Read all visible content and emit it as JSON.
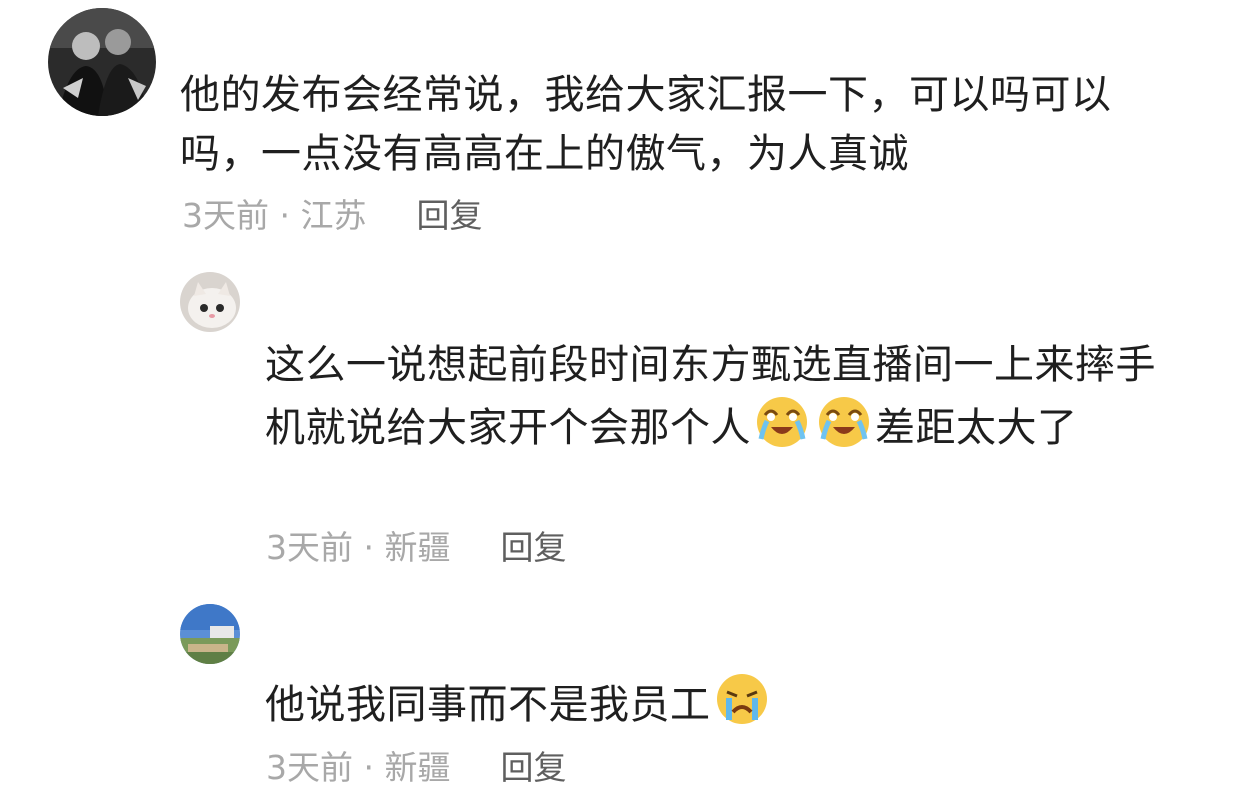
{
  "comments": [
    {
      "text": "他的发布会经常说，我给大家汇报一下，可以吗可以吗，一点没有高高在上的傲气，为人真诚",
      "time": "3天前",
      "location": "江苏",
      "separator": " · ",
      "reply_label": "回复",
      "avatar": "avatar-photo-dark"
    },
    {
      "text_part1": "这么一说想起前段时间东方甄选直播间一上来摔手机就说给大家开个会那个人",
      "emoji": [
        "laugh-cry-emoji",
        "laugh-cry-emoji"
      ],
      "text_part2": "差距太大了",
      "time": "3天前",
      "location": "新疆",
      "separator": " · ",
      "reply_label": "回复",
      "avatar": "avatar-cat"
    },
    {
      "text": "他说我同事而不是我员工",
      "emoji": [
        "crying-emoji"
      ],
      "time": "3天前",
      "location": "新疆",
      "separator": " · ",
      "reply_label": "回复",
      "avatar": "avatar-landscape"
    }
  ],
  "colors": {
    "text": "#1f1f1f",
    "meta": "#a8a8a8",
    "reply": "#5f5f5f"
  }
}
